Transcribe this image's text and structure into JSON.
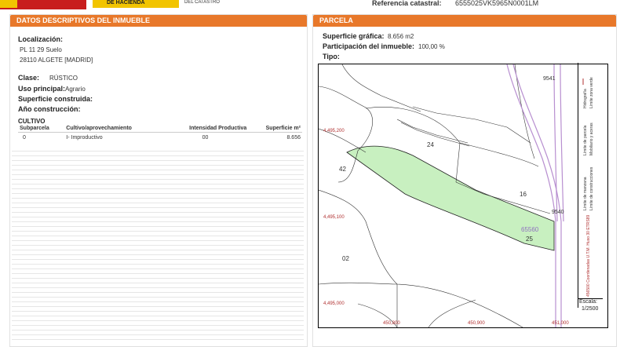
{
  "header": {
    "gov_label": "DE HACIENDA",
    "catastro_label": "DEL CATASTRO",
    "ref_label": "Referencia catastral:",
    "ref_value": "6555025VK5965N0001LM"
  },
  "left": {
    "title": "DATOS DESCRIPTIVOS DEL INMUEBLE",
    "localizacion_label": "Localización:",
    "localizacion_line1": "PL 11 29 Suelo",
    "localizacion_line2": "28110 ALGETE [MADRID]",
    "clase_label": "Clase:",
    "clase_value": "RÚSTICO",
    "uso_label": "Uso principal:",
    "uso_value": "Agrario",
    "superficie_label": "Superficie construida:",
    "ano_label": "Año construcción:",
    "cultivo_label": "CULTIVO",
    "table": {
      "headers": [
        "Subparcela",
        "Cultivo/aprovechamiento",
        "Intensidad Productiva",
        "Superficie m²"
      ],
      "rows": [
        [
          "0",
          "I- Improductivo",
          "00",
          "8.656"
        ]
      ]
    }
  },
  "right": {
    "title": "PARCELA",
    "superficie_label": "Superficie gráfica:",
    "superficie_value": "8.656 m2",
    "participacion_label": "Participación del inmueble:",
    "participacion_value": "100,00 %",
    "tipo_label": "Tipo:",
    "map": {
      "labels": {
        "y1": "4,495,200",
        "y2": "4,495,100",
        "y3": "4,495,000",
        "x1": "450,800",
        "x2": "450,900",
        "x3": "451,000",
        "p24": "24",
        "p42": "42",
        "p16": "16",
        "p25": "25",
        "p02": "02",
        "p9541": "9541",
        "p9540": "9540",
        "p65560": "65560"
      },
      "legend": [
        "Hidrografía",
        "Límite zona verde",
        "Límite de parcela",
        "Mobiliario y aceras",
        "Límite de construcciones",
        "Límite de manzana",
        "456500 Coordenadas U.T.M. Huso 30 ETRS89"
      ],
      "scale_label": "Escala:",
      "scale_value": "1/2500"
    }
  }
}
